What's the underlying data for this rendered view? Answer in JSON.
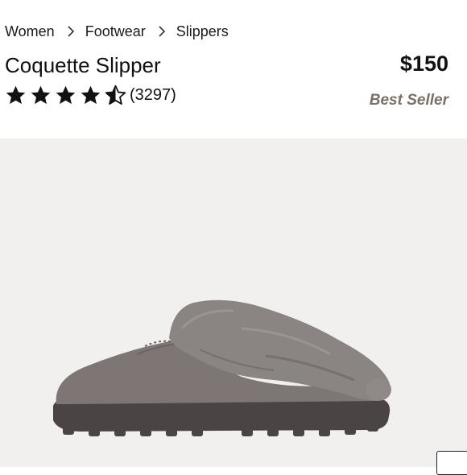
{
  "breadcrumb": {
    "items": [
      {
        "label": "Women"
      },
      {
        "label": "Footwear"
      },
      {
        "label": "Slippers"
      }
    ]
  },
  "product": {
    "title": "Coquette Slipper",
    "price": "$150",
    "badge": "Best Seller",
    "rating": 4.5,
    "rating_max": 5,
    "review_count": "(3297)"
  },
  "colors": {
    "text": "#111111",
    "badge": "#7b6f68",
    "image_background": "#f1f0ee",
    "slipper_suede": "#7d7675",
    "slipper_fur": "#8a8482",
    "sole": "#4a4544"
  },
  "icons": {
    "separator": "chevron-right-icon",
    "star_full": "star-filled-icon",
    "star_half": "star-half-icon"
  }
}
